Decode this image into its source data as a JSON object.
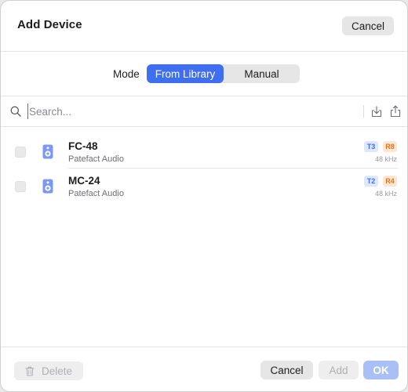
{
  "header": {
    "title": "Add Device",
    "cancel_label": "Cancel"
  },
  "mode": {
    "label": "Mode",
    "options": [
      "From Library",
      "Manual"
    ],
    "selected": "From Library"
  },
  "search": {
    "placeholder": "Search...",
    "value": ""
  },
  "devices": [
    {
      "name": "FC-48",
      "vendor": "Patefact Audio",
      "badge_t": "T3",
      "badge_r": "R8",
      "rate": "48 kHz",
      "checked": false
    },
    {
      "name": "MC-24",
      "vendor": "Patefact Audio",
      "badge_t": "T2",
      "badge_r": "R4",
      "rate": "48 kHz",
      "checked": false
    }
  ],
  "footer": {
    "delete_label": "Delete",
    "cancel_label": "Cancel",
    "add_label": "Add",
    "ok_label": "OK"
  },
  "colors": {
    "accent": "#3f6ff0",
    "ok_disabled": "#a9c0f7",
    "badge_t_bg": "#dfe7fd",
    "badge_r_bg": "#fce6d4",
    "badge_r_text": "#e07418"
  },
  "icons": [
    "search-icon",
    "import-icon",
    "export-icon",
    "speaker-icon",
    "trash-icon"
  ]
}
